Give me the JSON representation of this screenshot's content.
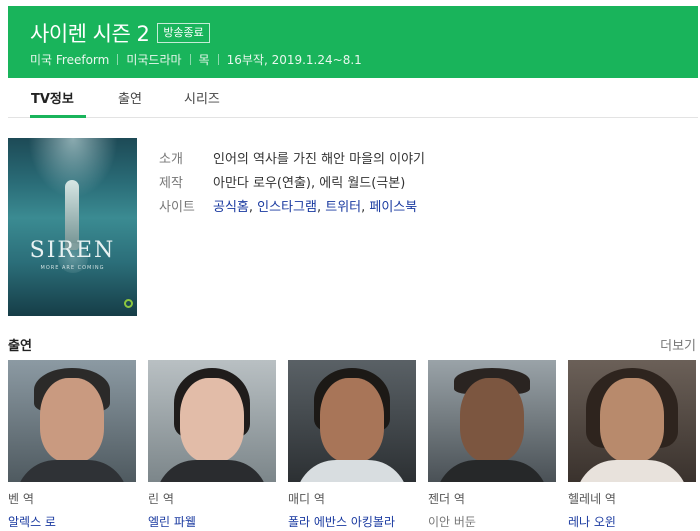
{
  "header": {
    "title": "사이렌 시즌 2",
    "badge": "방송종료",
    "meta": [
      "미국 Freeform",
      "미국드라마",
      "목",
      "16부작, 2019.1.24~8.1"
    ]
  },
  "tabs": [
    {
      "label": "TV정보",
      "active": true
    },
    {
      "label": "출연",
      "active": false
    },
    {
      "label": "시리즈",
      "active": false
    }
  ],
  "poster": {
    "title_text": "SIREN",
    "tagline": "MORE ARE COMING"
  },
  "info": {
    "intro_label": "소개",
    "intro_value": "인어의 역사를 가진 해안 마을의 이야기",
    "production_label": "제작",
    "production_value": "아만다 로우(연출), 에릭 월드(극본)",
    "site_label": "사이트",
    "sites": [
      "공식홈",
      "인스타그램",
      "트위터",
      "페이스북"
    ]
  },
  "cast_section": {
    "title": "출연",
    "more": "더보기"
  },
  "cast": [
    {
      "role": "벤 역",
      "name": "알렉스 로"
    },
    {
      "role": "린 역",
      "name": "엘린 파웰"
    },
    {
      "role": "매디 역",
      "name": "폴라 에반스 아킹볼라"
    },
    {
      "role": "젠더 역",
      "name": "이안 버둔"
    },
    {
      "role": "헬레네 역",
      "name": "레나 오윈"
    }
  ],
  "colors": {
    "accent": "#19b45b",
    "link": "#1a3aa0"
  }
}
